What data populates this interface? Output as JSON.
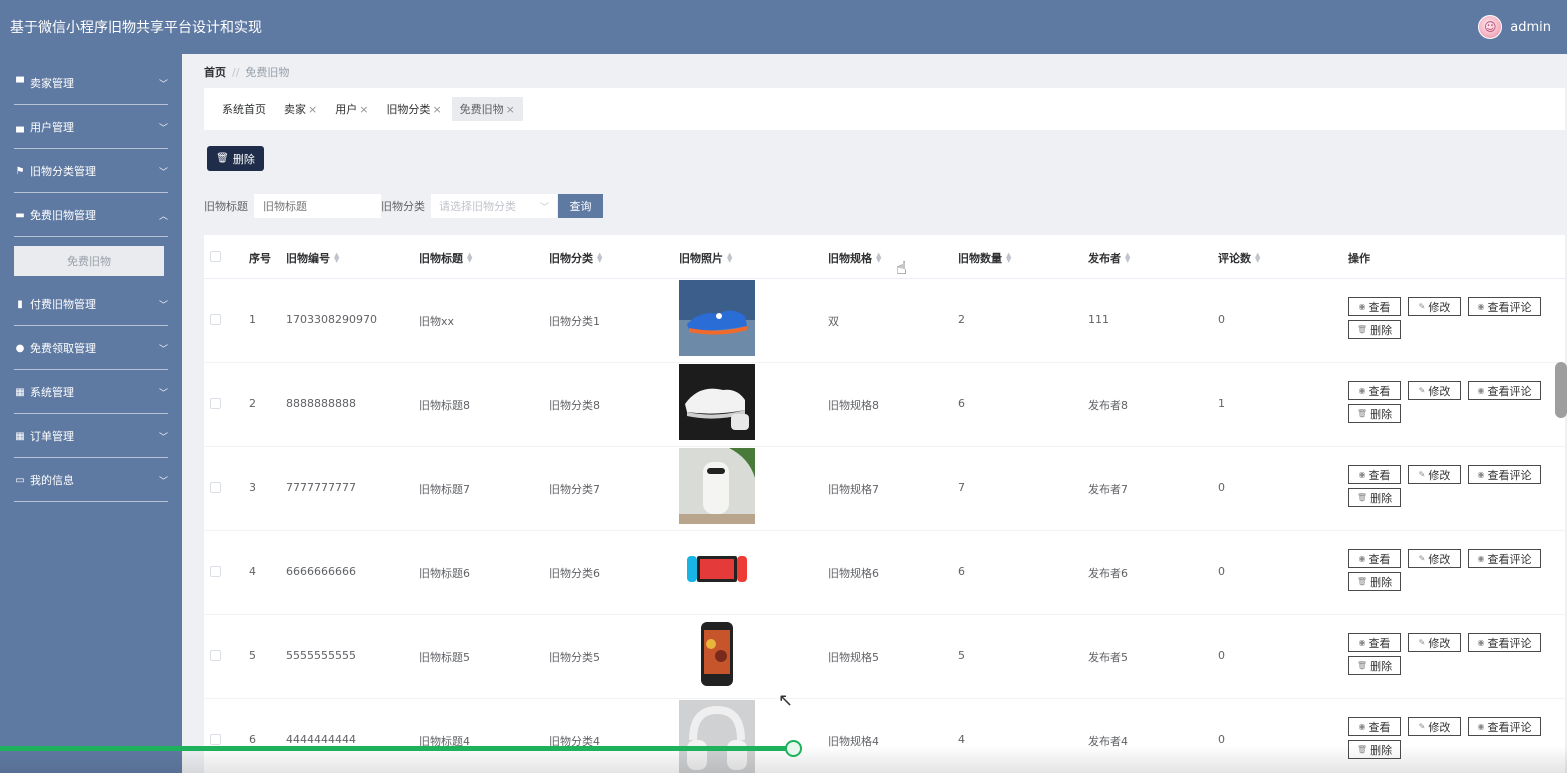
{
  "header": {
    "title": "基于微信小程序旧物共享平台设计和实现",
    "user": "admin"
  },
  "sidebar": {
    "items": [
      {
        "label": "卖家管理",
        "icon": "monitor-icon"
      },
      {
        "label": "用户管理",
        "icon": "briefcase-icon"
      },
      {
        "label": "旧物分类管理",
        "icon": "flag-icon"
      },
      {
        "label": "免费旧物管理",
        "icon": "ticket-icon",
        "expanded": true,
        "sub": "免费旧物"
      },
      {
        "label": "付费旧物管理",
        "icon": "bar-chart-icon"
      },
      {
        "label": "免费领取管理",
        "icon": "map-pin-icon"
      },
      {
        "label": "系统管理",
        "icon": "grid-icon"
      },
      {
        "label": "订单管理",
        "icon": "grid-icon"
      },
      {
        "label": "我的信息",
        "icon": "card-icon"
      }
    ]
  },
  "breadcrumb": {
    "home": "首页",
    "sep": "//",
    "current": "免费旧物"
  },
  "tags": [
    {
      "label": "系统首页",
      "closable": false
    },
    {
      "label": "卖家",
      "closable": true
    },
    {
      "label": "用户",
      "closable": true
    },
    {
      "label": "旧物分类",
      "closable": true
    },
    {
      "label": "免费旧物",
      "closable": true,
      "active": true
    }
  ],
  "toolbar": {
    "delete_label": "删除"
  },
  "search": {
    "title_label": "旧物标题",
    "title_placeholder": "旧物标题",
    "category_label": "旧物分类",
    "category_placeholder": "请选择旧物分类",
    "query_label": "查询"
  },
  "table": {
    "columns": [
      "序号",
      "旧物编号",
      "旧物标题",
      "旧物分类",
      "旧物照片",
      "旧物规格",
      "旧物数量",
      "发布者",
      "评论数",
      "操作"
    ],
    "rows": [
      {
        "idx": "1",
        "code": "1703308290970",
        "title": "旧物xx",
        "category": "旧物分类1",
        "spec": "双",
        "qty": "2",
        "publisher": "111",
        "comments": "0",
        "photo": "sneaker-image"
      },
      {
        "idx": "2",
        "code": "8888888888",
        "title": "旧物标题8",
        "category": "旧物分类8",
        "spec": "旧物规格8",
        "qty": "6",
        "publisher": "发布者8",
        "comments": "1",
        "photo": "white-shoe-image"
      },
      {
        "idx": "3",
        "code": "7777777777",
        "title": "旧物标题7",
        "category": "旧物分类7",
        "spec": "旧物规格7",
        "qty": "7",
        "publisher": "发布者7",
        "comments": "0",
        "photo": "air-purifier-image"
      },
      {
        "idx": "4",
        "code": "6666666666",
        "title": "旧物标题6",
        "category": "旧物分类6",
        "spec": "旧物规格6",
        "qty": "6",
        "publisher": "发布者6",
        "comments": "0",
        "photo": "game-console-image"
      },
      {
        "idx": "5",
        "code": "5555555555",
        "title": "旧物标题5",
        "category": "旧物分类5",
        "spec": "旧物规格5",
        "qty": "5",
        "publisher": "发布者5",
        "comments": "0",
        "photo": "phone-image"
      },
      {
        "idx": "6",
        "code": "4444444444",
        "title": "旧物标题4",
        "category": "旧物分类4",
        "spec": "旧物规格4",
        "qty": "4",
        "publisher": "发布者4",
        "comments": "0",
        "photo": "headphones-image"
      }
    ],
    "actions": {
      "view": "查看",
      "edit": "修改",
      "view_comments": "查看评论",
      "delete": "删除"
    }
  },
  "video": {
    "progress": 0.506
  },
  "colors": {
    "header_bg": "#5f7aa2",
    "dark_button": "#1f2d4a",
    "progress": "#1cb15a"
  }
}
